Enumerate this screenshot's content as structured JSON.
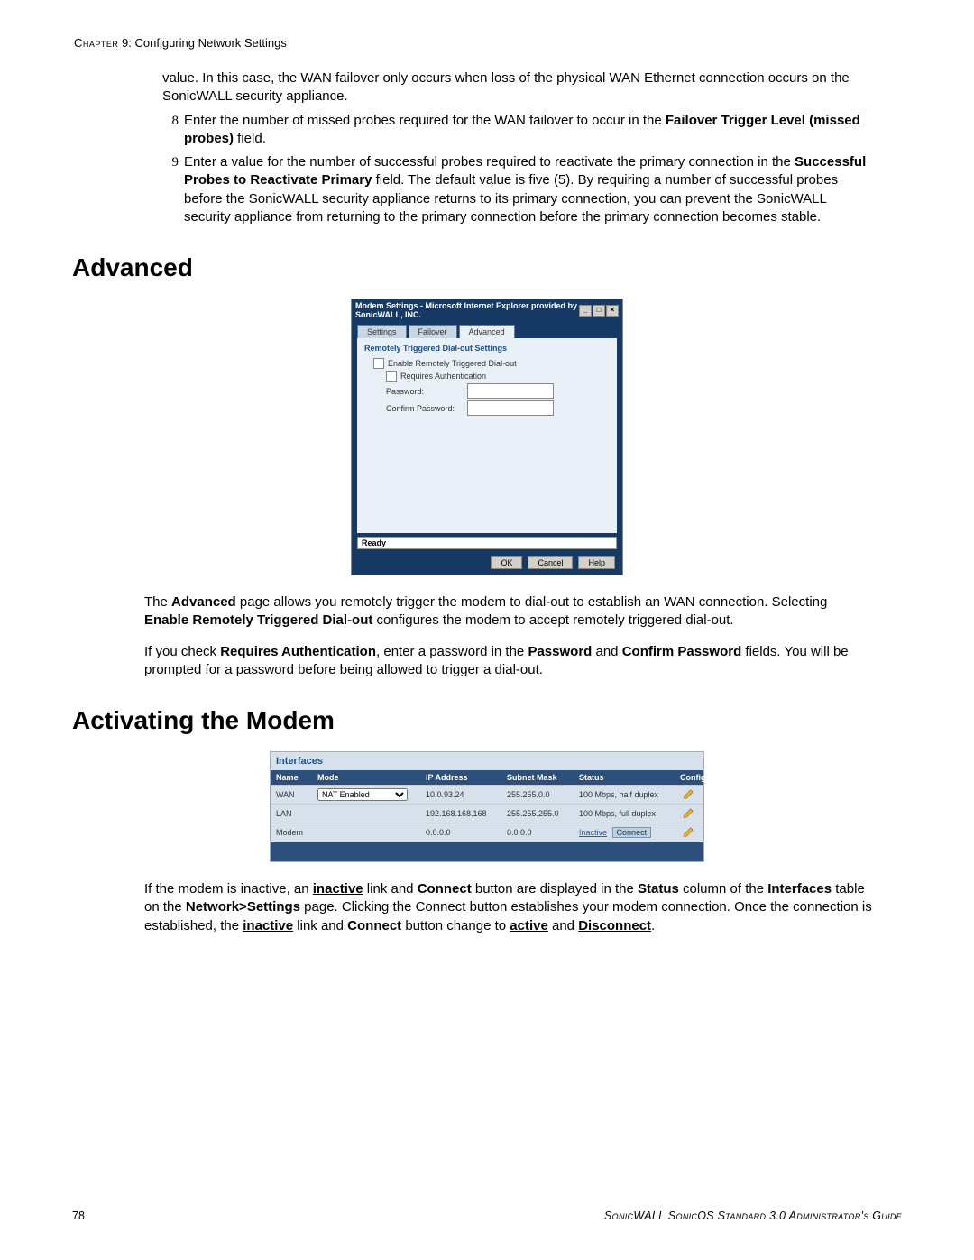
{
  "header": {
    "chapter_label": "Chapter",
    "chapter_num": "9",
    "chapter_title": "Configuring Network Settings"
  },
  "intro_continuation": "value. In this case, the WAN failover only occurs when loss of the physical WAN Ethernet connection occurs on the SonicWALL security appliance.",
  "steps": {
    "s8": {
      "num": "8",
      "pre": "Enter the number of missed probes required for the WAN failover to occur in the ",
      "bold": "Failover Trigger Level (missed probes)",
      "post": " field."
    },
    "s9": {
      "num": "9",
      "pre": "Enter a value for the number of successful probes required to reactivate the primary connection in the ",
      "bold": "Successful Probes to Reactivate Primary",
      "post": " field. The default value is five (5). By requiring a number of successful probes before the SonicWALL security appliance returns to its primary connection, you can prevent the SonicWALL security appliance from returning to the primary connection before the primary connection becomes stable."
    }
  },
  "section_advanced": "Advanced",
  "dialog": {
    "title": "Modem Settings - Microsoft Internet Explorer provided by SonicWALL, INC.",
    "tabs": {
      "settings": "Settings",
      "failover": "Failover",
      "advanced": "Advanced"
    },
    "section_title": "Remotely Triggered Dial-out Settings",
    "enable_label": "Enable Remotely Triggered Dial-out",
    "requires_auth_label": "Requires Authentication",
    "password_label": "Password:",
    "confirm_password_label": "Confirm Password:",
    "status": "Ready",
    "buttons": {
      "ok": "OK",
      "cancel": "Cancel",
      "help": "Help"
    }
  },
  "advanced_para1": {
    "a": "The ",
    "b": "Advanced",
    "c": " page allows you remotely trigger the modem to dial-out to establish an WAN connection. Selecting ",
    "d": "Enable Remotely Triggered Dial-out",
    "e": " configures the modem to accept remotely triggered dial-out."
  },
  "advanced_para2": {
    "a": "If you check ",
    "b": "Requires Authentication",
    "c": ", enter a password in the ",
    "d": "Password",
    "e": " and ",
    "f": "Confirm Password",
    "g": " fields. You will be prompted for a password before being allowed to trigger a dial-out."
  },
  "section_activating": "Activating the Modem",
  "interfaces": {
    "title": "Interfaces",
    "columns": {
      "name": "Name",
      "mode": "Mode",
      "ip": "IP Address",
      "mask": "Subnet Mask",
      "status": "Status",
      "configure": "Configure"
    },
    "rows": [
      {
        "name": "WAN",
        "mode": "NAT Enabled",
        "ip": "10.0.93.24",
        "mask": "255.255.0.0",
        "status": "100 Mbps, half duplex",
        "has_connect": false
      },
      {
        "name": "LAN",
        "mode": "",
        "ip": "192.168.168.168",
        "mask": "255.255.255.0",
        "status": "100 Mbps, full duplex",
        "has_connect": false
      },
      {
        "name": "Modem",
        "mode": "",
        "ip": "0.0.0.0",
        "mask": "0.0.0.0",
        "status_link": "Inactive",
        "connect_label": "Connect",
        "has_connect": true
      }
    ]
  },
  "activating_para": {
    "a": "If the modem is inactive, an ",
    "b": "inactive",
    "c": " link and ",
    "d": "Connect",
    "e": " button are displayed in the ",
    "f": "Status",
    "g": " column of the ",
    "h": "Interfaces",
    "i": " table on the ",
    "j": "Network>Settings",
    "k": " page. Clicking the Connect button establishes your modem connection. Once the connection is established, the ",
    "l": "inactive",
    "m": " link and ",
    "n": "Connect",
    "o": " button change to ",
    "p": "active",
    "q": " and ",
    "r": "Disconnect",
    "s": "."
  },
  "footer": {
    "page": "78",
    "guide_a": "SonicWALL SonicOS Standard 3.0 Administrator's Guide"
  }
}
